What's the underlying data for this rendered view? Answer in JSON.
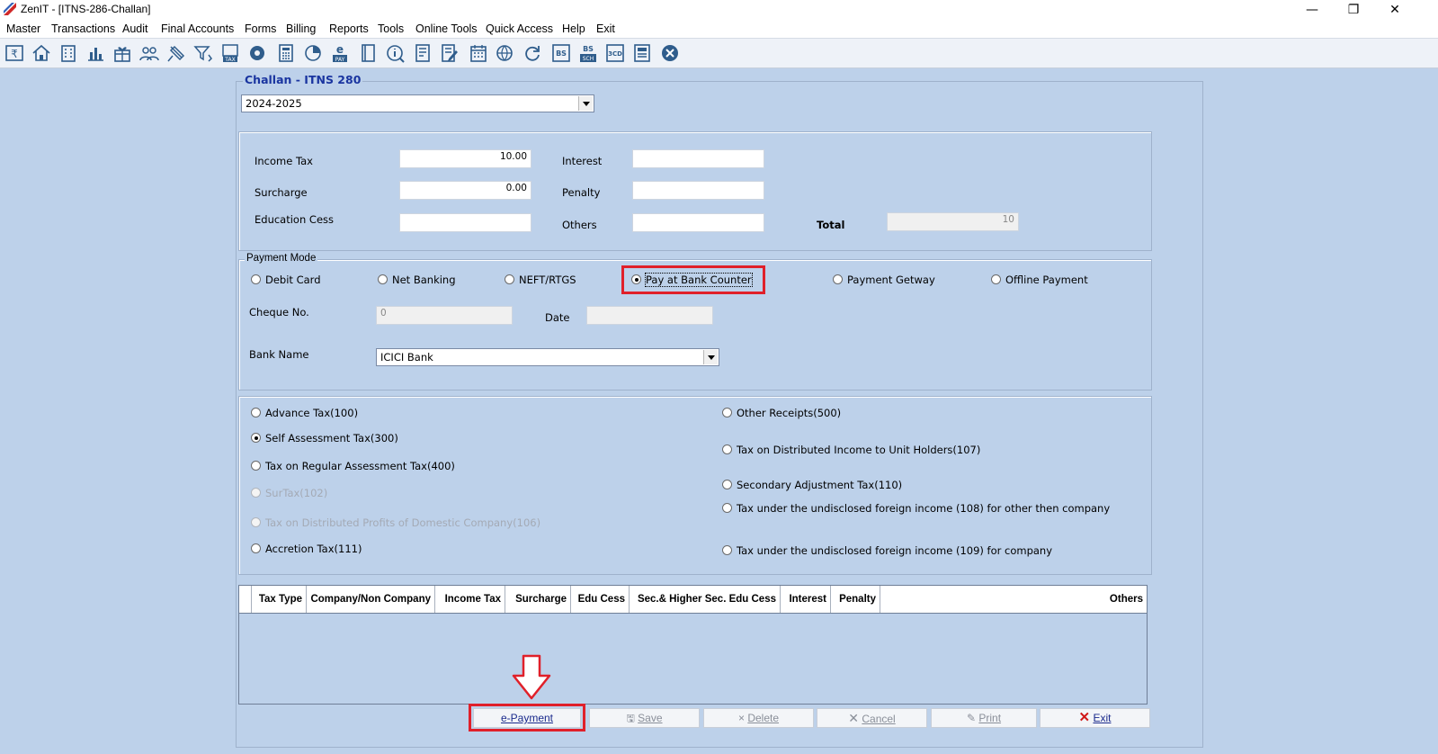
{
  "window": {
    "title": "ZenIT - [ITNS-286-Challan]",
    "minimize_glyph": "—",
    "restore_glyph": "❐",
    "close_glyph": "✕"
  },
  "menu": [
    "Master",
    "Transactions",
    "Audit",
    "Final Accounts",
    "Forms",
    "Billing",
    "Reports",
    "Tools",
    "Online Tools",
    "Quick Access",
    "Help",
    "Exit"
  ],
  "toolbar_icons": [
    "rupee-ledger-icon",
    "home-icon",
    "building-icon",
    "bar-chart-icon",
    "gift-icon",
    "users-icon",
    "pin-icon",
    "filter-icon",
    "tax-icon",
    "eye-icon",
    "calculator-icon",
    "pie-chart-icon",
    "epay-icon",
    "book-icon",
    "info-icon",
    "document-icon",
    "edit-document-icon",
    "calendar-icon",
    "globe-icon",
    "refresh-icon",
    "bs-icon",
    "bs-sch-icon",
    "3cd-icon",
    "report-icon",
    "close-circle-icon"
  ],
  "toolbar_texts": {
    "tax": "TAX",
    "pay": "PAY",
    "bs": "BS",
    "bs2": "BS",
    "sch": "SCH",
    "cd": "3CD"
  },
  "form": {
    "title": "Challan - ITNS 280",
    "year": "2024-2025",
    "amounts": {
      "income_tax_label": "Income Tax",
      "income_tax_value": "10.00",
      "surcharge_label": "Surcharge",
      "surcharge_value": "0.00",
      "education_cess_label": "Education Cess",
      "education_cess_value": "",
      "interest_label": "Interest",
      "interest_value": "",
      "penalty_label": "Penalty",
      "penalty_value": "",
      "others_label": "Others",
      "others_value": "",
      "total_label": "Total",
      "total_value": "10"
    },
    "payment_mode": {
      "legend": "Payment Mode",
      "options": [
        "Debit Card",
        "Net Banking",
        "NEFT/RTGS",
        "Pay at Bank Counter",
        "Payment Getway",
        "Offline Payment"
      ],
      "selected": "Pay at Bank Counter",
      "cheque_label": "Cheque No.",
      "cheque_value": "0",
      "date_label": "Date",
      "date_value": "",
      "bank_label": "Bank Name",
      "bank_value": "ICICI Bank"
    },
    "tax_types": {
      "left": [
        {
          "label": "Advance Tax(100)",
          "checked": false,
          "disabled": false
        },
        {
          "label": "Self Assessment Tax(300)",
          "checked": true,
          "disabled": false
        },
        {
          "label": "Tax on Regular Assessment Tax(400)",
          "checked": false,
          "disabled": false
        },
        {
          "label": "SurTax(102)",
          "checked": false,
          "disabled": true
        },
        {
          "label": "Tax on Distributed Profits of Domestic Company(106)",
          "checked": false,
          "disabled": true
        },
        {
          "label": "Accretion Tax(111)",
          "checked": false,
          "disabled": false
        }
      ],
      "right": [
        {
          "label": "Other Receipts(500)",
          "checked": false,
          "disabled": false
        },
        {
          "label": "Tax on Distributed Income to Unit Holders(107)",
          "checked": false,
          "disabled": false
        },
        {
          "label": "Secondary Adjustment Tax(110)",
          "checked": false,
          "disabled": false
        },
        {
          "label": "Tax under the undisclosed foreign income (108) for other then company",
          "checked": false,
          "disabled": false
        },
        {
          "label": "Tax under the undisclosed foreign income (109) for  company",
          "checked": false,
          "disabled": false
        }
      ]
    },
    "grid": {
      "columns": [
        "Tax Type",
        "Company/Non Company",
        "Income Tax",
        "Surcharge",
        "Edu Cess",
        "Sec.& Higher Sec. Edu Cess",
        "Interest",
        "Penalty",
        "Others"
      ],
      "rows": []
    },
    "buttons": {
      "epayment": "e-Payment",
      "save": "Save",
      "delete": "Delete",
      "cancel": "Cancel",
      "print": "Print",
      "exit": "Exit"
    },
    "highlight_color": "#e0202a"
  }
}
